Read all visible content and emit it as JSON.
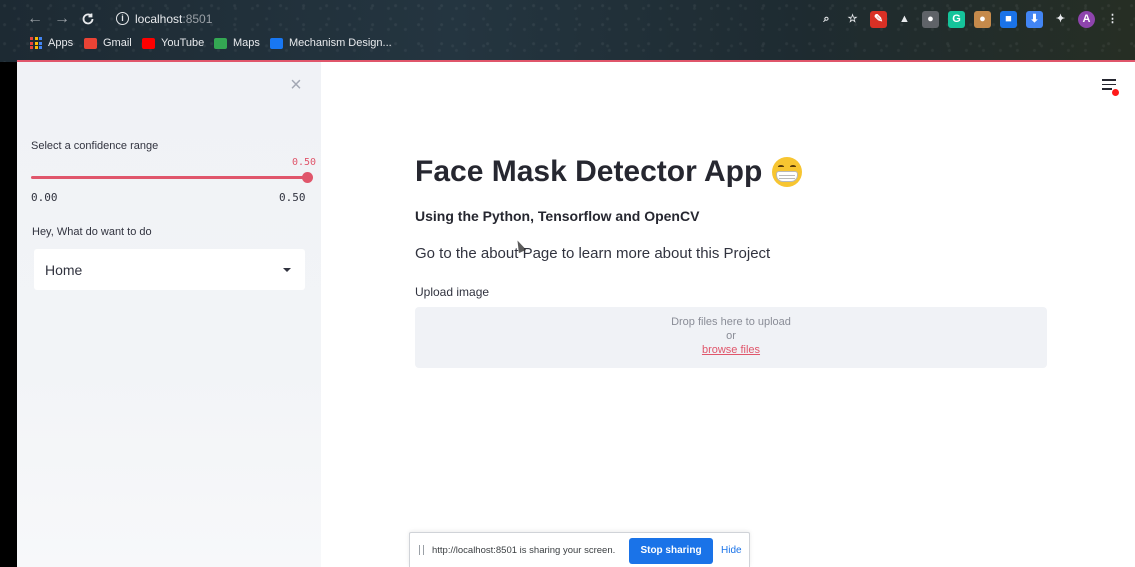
{
  "browser": {
    "url_host": "localhost",
    "url_port": ":8501",
    "nav": {
      "back": "←",
      "forward": "→",
      "reload": "C"
    },
    "bookmarks": [
      {
        "label": "Apps",
        "icon": "apps-grid-icon"
      },
      {
        "label": "Gmail",
        "icon": "gmail-icon",
        "color": "#ea4335"
      },
      {
        "label": "YouTube",
        "icon": "youtube-icon",
        "color": "#ff0000"
      },
      {
        "label": "Maps",
        "icon": "maps-icon",
        "color": "#34a853"
      },
      {
        "label": "Mechanism Design...",
        "icon": "facebook-icon",
        "color": "#1877f2"
      }
    ],
    "extensions": [
      {
        "name": "zoom-icon",
        "glyph": "⌕",
        "color": "transparent"
      },
      {
        "name": "star-icon",
        "glyph": "☆",
        "color": "transparent"
      },
      {
        "name": "pen-extension-icon",
        "glyph": "✎",
        "color": "#d93025"
      },
      {
        "name": "drive-icon",
        "glyph": "▲",
        "color": "transparent"
      },
      {
        "name": "extension-a-icon",
        "glyph": "●",
        "color": "#5f6368"
      },
      {
        "name": "grammarly-icon",
        "glyph": "G",
        "color": "#15c39a"
      },
      {
        "name": "cookie-icon",
        "glyph": "●",
        "color": "#c58a4b"
      },
      {
        "name": "screen-icon",
        "glyph": "■",
        "color": "#1a73e8"
      },
      {
        "name": "download-icon",
        "glyph": "⬇",
        "color": "#4285f4"
      },
      {
        "name": "puzzle-icon",
        "glyph": "✦",
        "color": "transparent"
      },
      {
        "name": "profile-avatar-icon",
        "glyph": "A",
        "color": "#8e44ad"
      },
      {
        "name": "kebab-menu-icon",
        "glyph": "⋮",
        "color": "transparent"
      }
    ]
  },
  "sidebar": {
    "close_glyph": "×",
    "confidence_label": "Select a confidence range",
    "slider": {
      "value_label": "0.50",
      "min_label": "0.00",
      "max_label": "0.50",
      "value": 0.5,
      "min": 0.0,
      "max": 0.5
    },
    "task_label": "Hey, What do want to do",
    "select_value": "Home"
  },
  "main": {
    "title": "Face Mask Detector App",
    "subtitle": "Using the Python, Tensorflow and OpenCV",
    "about_text": "Go to the about Page to learn more about this Project",
    "upload_label": "Upload image",
    "dropzone": {
      "line1": "Drop files here to upload",
      "or": "or",
      "browse": "browse files"
    }
  },
  "share_bar": {
    "text": "http://localhost:8501 is sharing your screen.",
    "stop_label": "Stop sharing",
    "hide_label": "Hide"
  },
  "colors": {
    "accent": "#e0566b",
    "primary_blue": "#1a73e8"
  }
}
